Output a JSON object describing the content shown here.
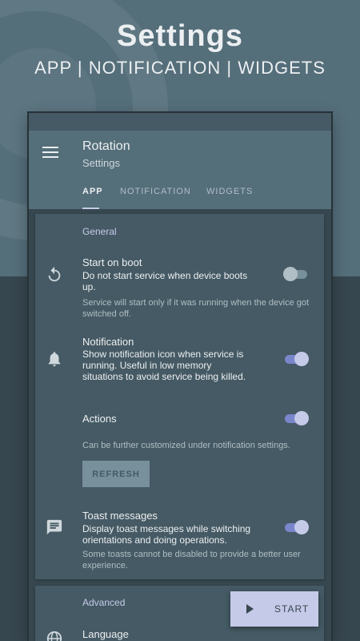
{
  "hero": {
    "title": "Settings",
    "subtitle": "APP | NOTIFICATION | WIDGETS"
  },
  "appbar": {
    "title": "Rotation",
    "subtitle": "Settings",
    "menu_icon": "menu-icon"
  },
  "tabs": [
    {
      "label": "APP",
      "active": true
    },
    {
      "label": "NOTIFICATION",
      "active": false
    },
    {
      "label": "WIDGETS",
      "active": false
    }
  ],
  "general": {
    "header": "General",
    "start_on_boot": {
      "icon": "restart-icon",
      "title": "Start on boot",
      "summary": "Do not start service when device boots up.",
      "note": "Service will start only if it was running when the device got switched off.",
      "enabled": false
    },
    "notification": {
      "icon": "bell-icon",
      "title": "Notification",
      "summary": "Show notification icon when service is running. Useful in low memory situations to avoid service being killed.",
      "enabled": true
    },
    "actions": {
      "title": "Actions",
      "note": "Can be further customized under notification settings.",
      "enabled": true,
      "refresh_label": "REFRESH"
    },
    "toast": {
      "icon": "message-icon",
      "title": "Toast messages",
      "summary": "Display toast messages while switching orientations and doing operations.",
      "note": "Some toasts cannot be disabled to provide a better user experience.",
      "enabled": true
    }
  },
  "advanced": {
    "header": "Advanced",
    "language": {
      "icon": "globe-icon",
      "title": "Language"
    }
  },
  "fab": {
    "label": "START",
    "icon": "play-icon"
  },
  "colors": {
    "primary": "#546E7A",
    "background": "#37474F",
    "card": "#455A64",
    "accent": "#C5CAE9"
  }
}
